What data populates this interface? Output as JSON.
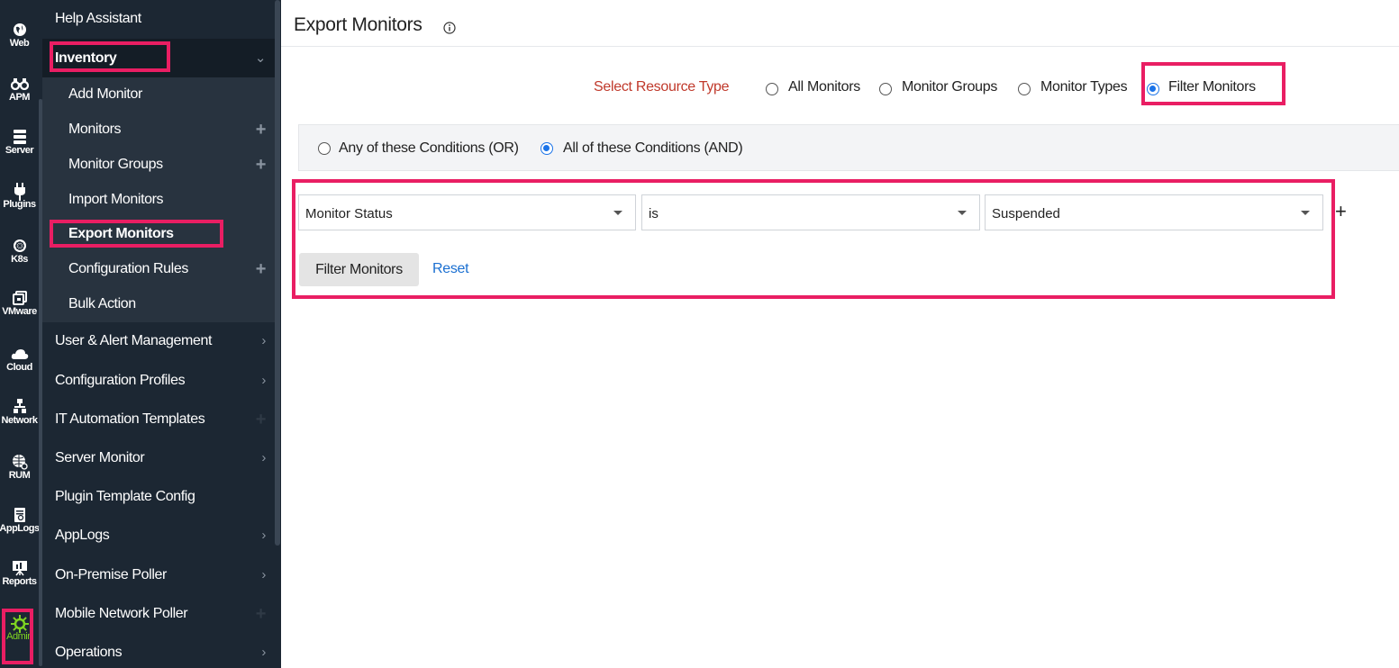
{
  "rail": {
    "items": [
      {
        "label": "Web",
        "icon": "globe-icon"
      },
      {
        "label": "APM",
        "icon": "binoculars-icon"
      },
      {
        "label": "Server",
        "icon": "server-icon"
      },
      {
        "label": "Plugins",
        "icon": "plug-icon"
      },
      {
        "label": "K8s",
        "icon": "kubernetes-icon"
      },
      {
        "label": "VMware",
        "icon": "vmware-icon"
      },
      {
        "label": "Cloud",
        "icon": "cloud-icon"
      },
      {
        "label": "Network",
        "icon": "network-icon"
      },
      {
        "label": "RUM",
        "icon": "rum-globe-icon"
      },
      {
        "label": "AppLogs",
        "icon": "applogs-icon"
      },
      {
        "label": "Reports",
        "icon": "reports-icon"
      },
      {
        "label": "Admin",
        "icon": "gear-icon"
      }
    ],
    "active_color": "#7ed321"
  },
  "sidebar": {
    "help": "Help Assistant",
    "inventory": "Inventory",
    "sub_items": {
      "add_monitor": "Add Monitor",
      "monitors": "Monitors",
      "monitor_groups": "Monitor Groups",
      "import_monitors": "Import Monitors",
      "export_monitors": "Export Monitors",
      "configuration_rules": "Configuration Rules",
      "bulk_action": "Bulk Action"
    },
    "sections": {
      "user_alert": "User & Alert Management",
      "config_profiles": "Configuration Profiles",
      "it_automation": "IT Automation Templates",
      "server_monitor": "Server Monitor",
      "plugin_template": "Plugin Template Config",
      "applogs": "AppLogs",
      "onpremise_poller": "On-Premise Poller",
      "mobile_poller": "Mobile Network Poller",
      "operations": "Operations"
    }
  },
  "main": {
    "title": "Export Monitors",
    "resource_type_label": "Select Resource Type",
    "resource_types": {
      "all": "All Monitors",
      "groups": "Monitor Groups",
      "types": "Monitor Types",
      "filter": "Filter Monitors"
    },
    "selected_resource_type": "Filter Monitors",
    "conditions": {
      "or": "Any of these Conditions (OR)",
      "and": "All of these Conditions (AND)"
    },
    "filter": {
      "field": "Monitor Status",
      "operator": "is",
      "value": "Suspended"
    },
    "buttons": {
      "filter": "Filter Monitors",
      "reset": "Reset",
      "add": "+"
    }
  },
  "colors": {
    "highlight": "#e91e63",
    "sidebar_bg": "#1c2733",
    "link": "#1a6fd1",
    "label_red": "#c0392b",
    "radio_on": "#1a73e8"
  }
}
